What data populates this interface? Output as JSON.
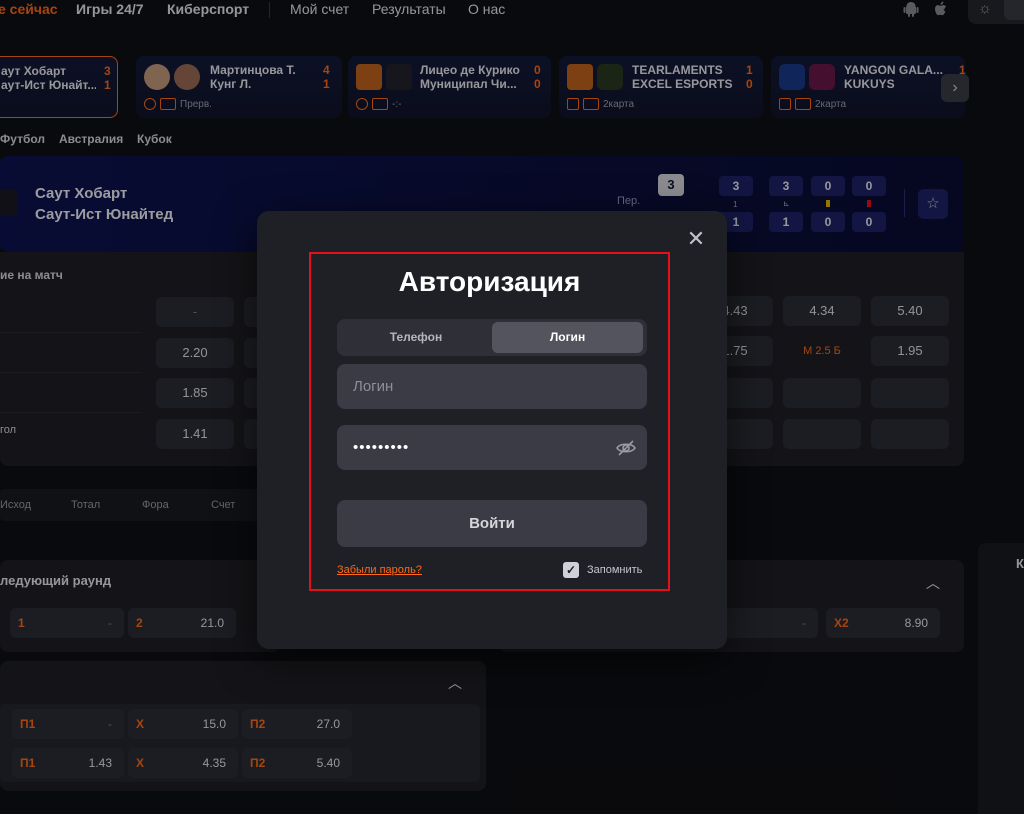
{
  "nav": {
    "live": "е сейчас",
    "games247": "Игры 24/7",
    "esports": "Киберспорт",
    "myaccount": "Мой счет",
    "results": "Результаты",
    "about": "О нас"
  },
  "events": [
    {
      "team1": "аут Хобарт",
      "team2": "аут-Ист Юнайт...",
      "score1": "3",
      "score2": "1",
      "status": ""
    },
    {
      "team1": "Мартинцова Т.",
      "team2": "Кунг Л.",
      "score1": "4",
      "score2": "1",
      "status": "Прерв."
    },
    {
      "team1": "Лицео де Курико",
      "team2": "Муниципал Чи...",
      "score1": "0",
      "score2": "0",
      "status": "-:-"
    },
    {
      "team1": "TEARLAMENTS",
      "team2": "EXCEL ESPORTS",
      "score1": "1",
      "score2": "0",
      "status": "2карта"
    },
    {
      "team1": "YANGON GALA...",
      "team2": "KUKUYS",
      "score1": "1",
      "score2": "",
      "status": "2карта"
    }
  ],
  "breadcrumb": [
    "Футбол",
    "Австралия",
    "Кубок"
  ],
  "match": {
    "team1": "Саут Хобарт",
    "team2": "Саут-Ист Юнайтед",
    "period_label": "Пер.",
    "score_main": "3",
    "stats_top": [
      "3",
      "3",
      "0",
      "0"
    ],
    "stats_sub": [
      "1",
      "",
      "",
      ""
    ],
    "stats_bottom": [
      "1",
      "1",
      "0",
      "0"
    ]
  },
  "odds": {
    "section": "ие на матч",
    "row4_label": "гол",
    "left_col": [
      "-",
      "2.20",
      "1.85",
      "1.41"
    ],
    "right_a": [
      "4.43",
      "1.75"
    ],
    "right_b": [
      "4.34",
      "М 2.5 Б"
    ],
    "right_c": [
      "5.40",
      "1.95"
    ]
  },
  "market_tabs": [
    "Исход",
    "Тотал",
    "Фора",
    "Счет"
  ],
  "next_round": {
    "title": "ледующий раунд",
    "cells": [
      {
        "k": "1",
        "v": "-"
      },
      {
        "k": "2",
        "v": "21.0"
      }
    ],
    "right_cells": [
      {
        "k": "2",
        "v": "-"
      },
      {
        "k": "X2",
        "v": "8.90"
      }
    ]
  },
  "bottom_market": {
    "rows": [
      [
        {
          "k": "П1",
          "v": "-"
        },
        {
          "k": "X",
          "v": "15.0"
        },
        {
          "k": "П2",
          "v": "27.0"
        }
      ],
      [
        {
          "k": "П1",
          "v": "1.43"
        },
        {
          "k": "X",
          "v": "4.35"
        },
        {
          "k": "П2",
          "v": "5.40"
        }
      ]
    ]
  },
  "side": {
    "letter": "К"
  },
  "modal": {
    "title": "Авторизация",
    "tab_phone": "Телефон",
    "tab_login": "Логин",
    "login_placeholder": "Логин",
    "password_value": "•••••••••",
    "submit": "Войти",
    "forgot": "Забыли пароль?",
    "remember": "Запомнить"
  },
  "colors": {
    "accent": "#ff6a1a",
    "highlight": "#e3121a",
    "header_bg": "#0d1350"
  }
}
